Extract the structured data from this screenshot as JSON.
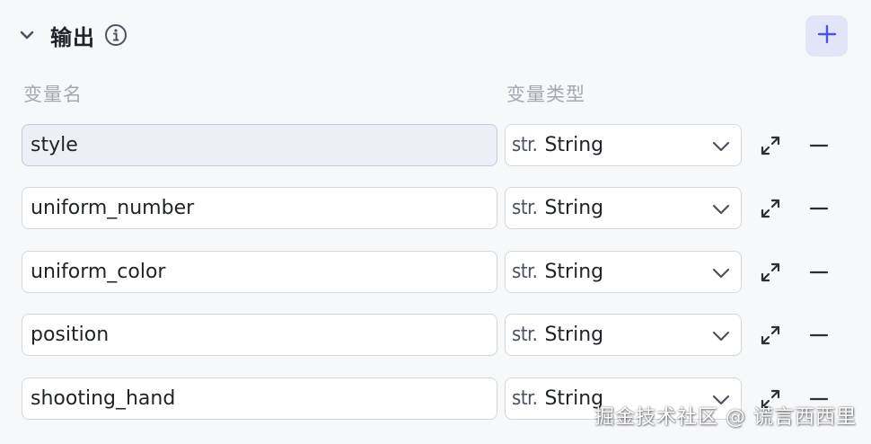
{
  "output_section": {
    "title": "输出",
    "collapse_icon": "chevron-down-icon",
    "info_icon": "info-icon",
    "add_icon": "plus-icon"
  },
  "columns": {
    "name_header": "变量名",
    "type_header": "变量类型"
  },
  "variables": [
    {
      "name": "style",
      "type_prefix": "str.",
      "type_label": "String",
      "active": true
    },
    {
      "name": "uniform_number",
      "type_prefix": "str.",
      "type_label": "String",
      "active": false
    },
    {
      "name": "uniform_color",
      "type_prefix": "str.",
      "type_label": "String",
      "active": false
    },
    {
      "name": "position",
      "type_prefix": "str.",
      "type_label": "String",
      "active": false
    },
    {
      "name": "shooting_hand",
      "type_prefix": "str.",
      "type_label": "String",
      "active": false
    }
  ],
  "row_icons": {
    "expand": "expand-icon",
    "remove": "minus-icon",
    "dropdown": "chevron-down-icon"
  },
  "watermark": "掘金技术社区 @ 谎言西西里",
  "colors": {
    "background": "#f7f8fa",
    "accent": "#4d53e8",
    "add_button_bg": "#e2e5f7",
    "border": "#d4d7de",
    "active_input_bg": "#eef0f8",
    "header_text": "#a4a8b0"
  }
}
